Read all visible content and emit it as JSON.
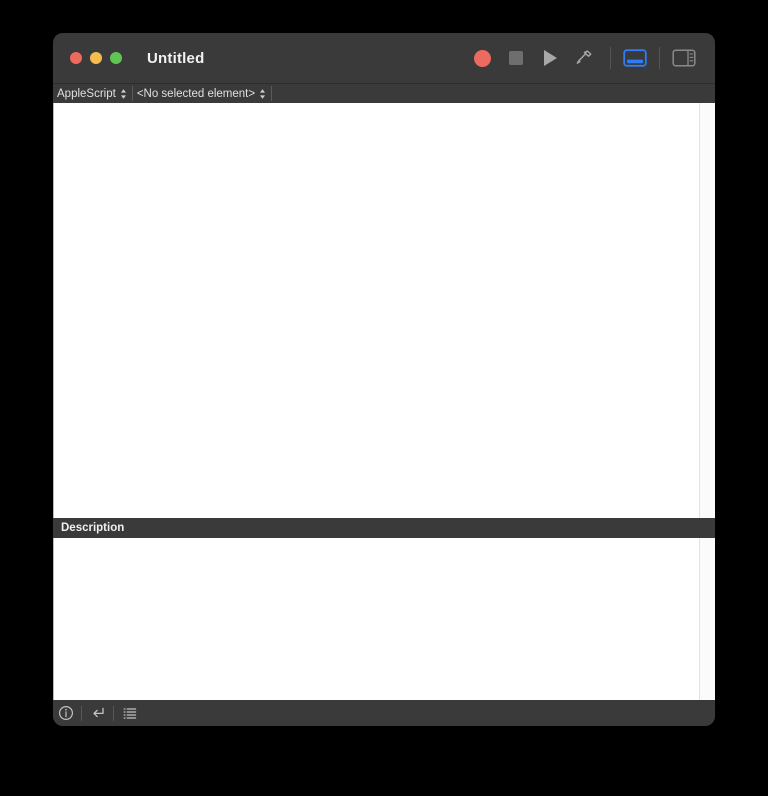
{
  "window": {
    "title": "Untitled",
    "traffic_lights": [
      {
        "name": "close",
        "color": "#ed6a5e"
      },
      {
        "name": "minimize",
        "color": "#f5bd4f"
      },
      {
        "name": "zoom",
        "color": "#61c554"
      }
    ]
  },
  "toolbar": {
    "record_label": "Record",
    "stop_label": "Stop",
    "run_label": "Run",
    "compile_label": "Compile",
    "bottom_pane_toggle_label": "Show Bottom Pane",
    "side_pane_toggle_label": "Show Side Pane",
    "record_color": "#ec6a5e",
    "stop_color": "#6e6e6e",
    "run_color": "#a8a8a8",
    "compile_color": "#a8a8a8",
    "active_toggle_color": "#2f7cf6",
    "inactive_toggle_color": "#8a8a8a"
  },
  "selector_bar": {
    "language": "AppleScript",
    "element": "<No selected element>"
  },
  "editor": {
    "content": "",
    "caret_color": "#5b9dfb"
  },
  "description": {
    "header": "Description",
    "content": ""
  },
  "bottom_bar": {
    "items": [
      {
        "name": "description-tab",
        "label": "Description"
      },
      {
        "name": "result-tab",
        "label": "Result"
      },
      {
        "name": "log-tab",
        "label": "Log"
      }
    ],
    "icon_color": "#c3c3c3"
  }
}
